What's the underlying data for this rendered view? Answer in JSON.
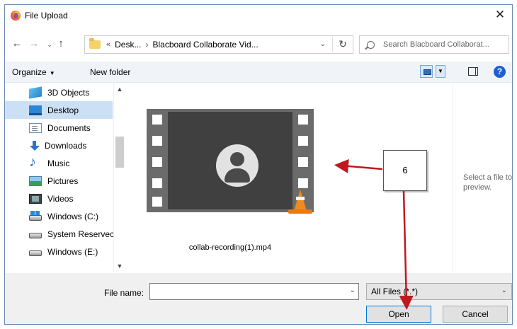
{
  "window": {
    "title": "File Upload",
    "close_glyph": "✕"
  },
  "nav": {
    "back_glyph": "←",
    "forward_glyph": "→",
    "recent_glyph": "⌄",
    "up_glyph": "↑",
    "breadcrumb_lead": "«",
    "breadcrumb": [
      "Desk...",
      "Blacboard Collaborate Vid..."
    ],
    "breadcrumb_separator": "›",
    "dropdown_glyph": "⌄",
    "refresh_glyph": "↻",
    "search_placeholder": "Search Blacboard Collaborat..."
  },
  "toolbar": {
    "organize_label": "Organize",
    "organize_caret": "▼",
    "new_folder_label": "New folder",
    "view_dropdown_glyph": "▼",
    "help_label": "?"
  },
  "sidebar": {
    "items": [
      {
        "label": "3D Objects",
        "icon": "cube-3d-icon"
      },
      {
        "label": "Desktop",
        "icon": "desktop-icon",
        "selected": true
      },
      {
        "label": "Documents",
        "icon": "documents-icon"
      },
      {
        "label": "Downloads",
        "icon": "downloads-icon"
      },
      {
        "label": "Music",
        "icon": "music-icon"
      },
      {
        "label": "Pictures",
        "icon": "pictures-icon"
      },
      {
        "label": "Videos",
        "icon": "videos-icon"
      },
      {
        "label": "Windows (C:)",
        "icon": "drive-windows-icon"
      },
      {
        "label": "System Reservec",
        "icon": "drive-icon"
      },
      {
        "label": "Windows (E:)",
        "icon": "drive-icon"
      }
    ],
    "scroll_up_glyph": "▲",
    "scroll_down_glyph": "▼"
  },
  "files": [
    {
      "name": "collab-recording(1).mp4",
      "icon": "video-thumbnail-icon",
      "overlay_icon": "vlc-cone-icon"
    }
  ],
  "preview": {
    "text": "Select a file to preview."
  },
  "annotation": {
    "callout_number": "6",
    "arrow_color": "#c0181e"
  },
  "bottom": {
    "file_name_label": "File name:",
    "file_name_value": "",
    "file_type_value": "All Files (*.*)",
    "dropdown_glyph": "⌄",
    "open_label": "Open",
    "cancel_label": "Cancel"
  },
  "colors": {
    "selection": "#cce0f5",
    "accent_blue": "#0078d7",
    "vlc_orange": "#f08a1a"
  }
}
